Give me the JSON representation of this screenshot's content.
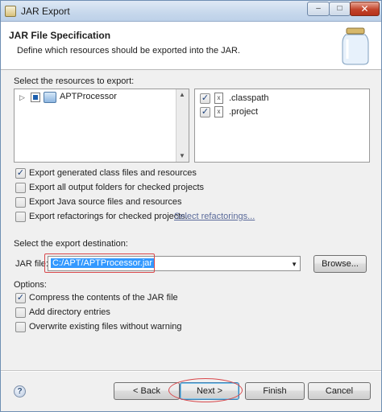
{
  "window": {
    "title": "JAR Export",
    "min_glyph": "–",
    "max_glyph": "□",
    "close_glyph": "✕"
  },
  "header": {
    "title": "JAR File Specification",
    "description": "Define which resources should be exported into the JAR."
  },
  "resources": {
    "label": "Select the resources to export:",
    "tree": [
      {
        "label": "APTProcessor",
        "expander": "▷"
      }
    ],
    "files": [
      {
        "label": ".classpath",
        "checked": "✓",
        "icon": "x"
      },
      {
        "label": ".project",
        "checked": "✓",
        "icon": "x"
      }
    ]
  },
  "options_export": [
    {
      "label": "Export generated class files and resources",
      "checked": "✓"
    },
    {
      "label": "Export all output folders for checked projects",
      "checked": ""
    },
    {
      "label": "Export Java source files and resources",
      "checked": ""
    },
    {
      "label": "Export refactorings for checked projects.",
      "checked": "",
      "link": "Select refactorings..."
    }
  ],
  "destination": {
    "label": "Select the export destination:",
    "jar_label": "JAR file:",
    "jar_value": "C:/APT/APTProcessor.jar",
    "browse_label": "Browse..."
  },
  "options": {
    "label": "Options:",
    "items": [
      {
        "label": "Compress the contents of the JAR file",
        "checked": "✓"
      },
      {
        "label": "Add directory entries",
        "checked": ""
      },
      {
        "label": "Overwrite existing files without warning",
        "checked": ""
      }
    ]
  },
  "footer": {
    "help_glyph": "?",
    "back_label": "< Back",
    "next_label": "Next >",
    "finish_label": "Finish",
    "cancel_label": "Cancel"
  }
}
